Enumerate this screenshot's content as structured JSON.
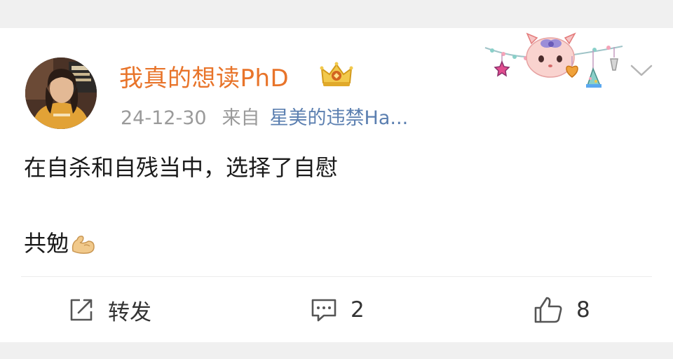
{
  "post": {
    "author": {
      "name": "我真的想读PhD",
      "badge_icon": "crown-vip-icon"
    },
    "timestamp": "24-12-30",
    "from_label": "来自",
    "source": "星美的违禁Ha...",
    "content_line1": "在自杀和自残当中，选择了自慰",
    "content_line2": "共勉",
    "content_emoji": "flexed-biceps-icon"
  },
  "actions": {
    "share_label": "转发",
    "comment_count": "2",
    "like_count": "8"
  },
  "colors": {
    "username": "#e8742a",
    "source_link": "#5b7fb0",
    "meta_gray": "#9a9a9a",
    "background": "#f0f0f0",
    "card": "#ffffff"
  }
}
